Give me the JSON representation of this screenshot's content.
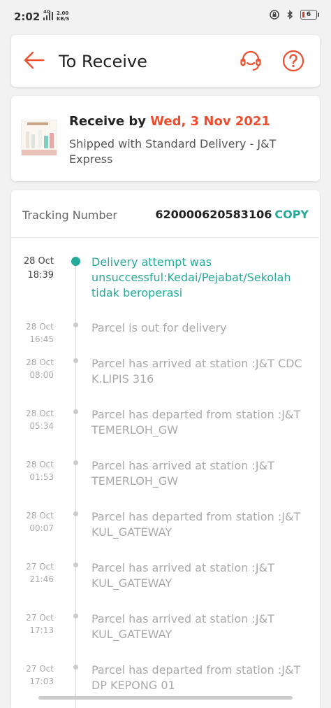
{
  "status_bar": {
    "time": "2:02",
    "network": "4G",
    "speed_value": "2.00",
    "speed_unit": "KB/S",
    "battery_level": "6"
  },
  "header": {
    "title": "To Receive"
  },
  "delivery": {
    "receive_prefix": "Receive by ",
    "receive_date": "Wed, 3 Nov 2021",
    "shipping_text": "Shipped with Standard Delivery - J&T Express"
  },
  "tracking": {
    "label": "Tracking Number",
    "number": "620000620583106",
    "copy_label": "COPY"
  },
  "events": [
    {
      "date": "28 Oct",
      "time": "18:39",
      "text": "Delivery attempt was unsuccessful:Kedai/Pejabat/Sekolah tidak beroperasi",
      "active": true
    },
    {
      "date": "28 Oct",
      "time": "16:45",
      "text": "Parcel is out for delivery"
    },
    {
      "date": "28 Oct",
      "time": "08:00",
      "text": "Parcel has arrived at station :J&T CDC K.LIPIS 316"
    },
    {
      "date": "28 Oct",
      "time": "05:34",
      "text": "Parcel has departed from station :J&T TEMERLOH_GW"
    },
    {
      "date": "28 Oct",
      "time": "01:53",
      "text": "Parcel has arrived at station :J&T TEMERLOH_GW"
    },
    {
      "date": "28 Oct",
      "time": "00:07",
      "text": "Parcel has departed from station :J&T KUL_GATEWAY"
    },
    {
      "date": "27 Oct",
      "time": "21:46",
      "text": "Parcel has arrived at station :J&T KUL_GATEWAY"
    },
    {
      "date": "27 Oct",
      "time": "17:13",
      "text": "Parcel has arrived at station :J&T KUL_GATEWAY"
    },
    {
      "date": "27 Oct",
      "time": "17:03",
      "text": "Parcel has departed from station :J&T DP KEPONG 01"
    }
  ],
  "colors": {
    "brand": "#ee4d2d",
    "accent": "#26aa99"
  }
}
